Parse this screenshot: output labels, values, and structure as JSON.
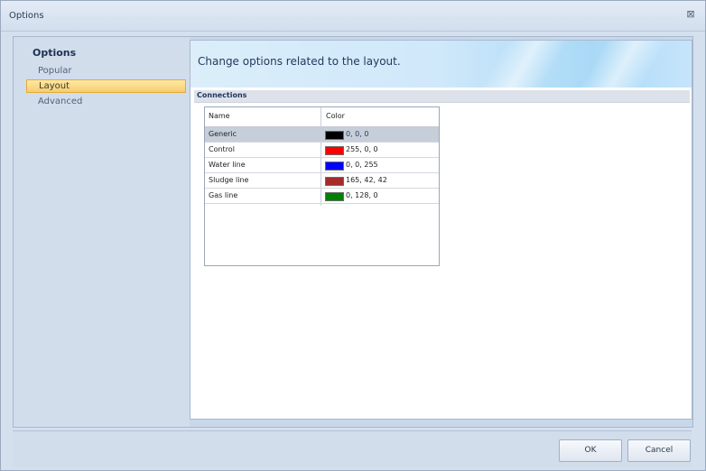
{
  "window": {
    "title": "Options",
    "close_glyph": "⊠"
  },
  "nav": {
    "title": "Options",
    "items": [
      {
        "label": "Popular",
        "selected": false
      },
      {
        "label": "Layout",
        "selected": true
      },
      {
        "label": "Advanced",
        "selected": false
      }
    ]
  },
  "panel": {
    "heading": "Change options related to the layout.",
    "section": "Connections",
    "grid": {
      "columns": [
        "Name",
        "Color"
      ],
      "rows": [
        {
          "name": "Generic",
          "color": "#000000",
          "value": "0, 0, 0",
          "selected": true
        },
        {
          "name": "Control",
          "color": "#ff0000",
          "value": "255, 0, 0",
          "selected": false
        },
        {
          "name": "Water line",
          "color": "#0000ff",
          "value": "0, 0, 255",
          "selected": false
        },
        {
          "name": "Sludge line",
          "color": "#a52a2a",
          "value": "165, 42, 42",
          "selected": false
        },
        {
          "name": "Gas line",
          "color": "#008000",
          "value": "0, 128, 0",
          "selected": false
        }
      ]
    }
  },
  "footer": {
    "ok_label": "OK",
    "cancel_label": "Cancel"
  }
}
